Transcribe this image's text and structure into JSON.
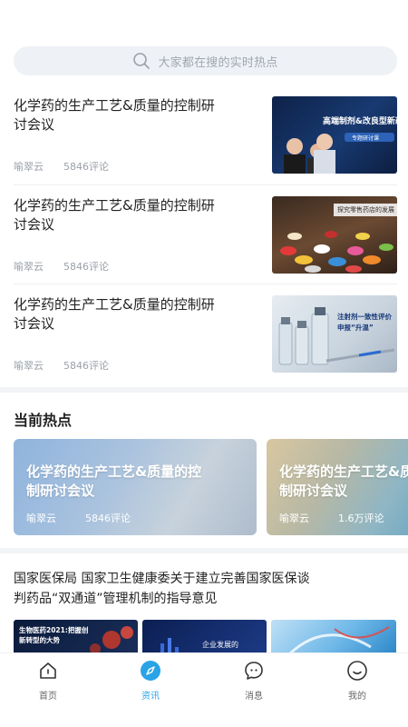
{
  "search": {
    "placeholder": "大家都在搜的实时热点"
  },
  "articles": [
    {
      "title": "化学药的生产工艺&质量的控制研讨会议",
      "author": "喻翠云",
      "comments": "5846评论",
      "thumb_caption": "高端制剂&改良型新药",
      "thumb_sub": "专题研讨课"
    },
    {
      "title": "化学药的生产工艺&质量的控制研讨会议",
      "author": "喻翠云",
      "comments": "5846评论",
      "thumb_caption": "探究零售药店的发展"
    },
    {
      "title": "化学药的生产工艺&质量的控制研讨会议",
      "author": "喻翠云",
      "comments": "5846评论",
      "thumb_caption": "注射剂一致性评价申报“升温”"
    }
  ],
  "hot": {
    "section_title": "当前热点",
    "cards": [
      {
        "title": "化学药的生产工艺&质量的控制研讨会议",
        "author": "喻翠云",
        "comments": "5846评论"
      },
      {
        "title": "化学药的生产工艺&质量的控制研讨会议",
        "author": "喻翠云",
        "comments": "1.6万评论"
      }
    ]
  },
  "news": {
    "title": "国家医保局 国家卫生健康委关于建立完善国家医保谈判药品“双通道”管理机制的指导意见",
    "images": [
      {
        "caption": "生物医药2021:把握创新转型的大势"
      },
      {
        "caption": "企业发展的"
      },
      {
        "caption": ""
      }
    ]
  },
  "tabbar": {
    "tabs": [
      {
        "label": "首页",
        "icon": "home-icon",
        "active": false
      },
      {
        "label": "资讯",
        "icon": "compass-icon",
        "active": true
      },
      {
        "label": "消息",
        "icon": "message-icon",
        "active": false
      },
      {
        "label": "我的",
        "icon": "profile-icon",
        "active": false
      }
    ]
  },
  "colors": {
    "accent": "#2aa3e6",
    "text": "#222222",
    "muted": "#9aa0a8",
    "search_bg": "#eef1f5"
  }
}
